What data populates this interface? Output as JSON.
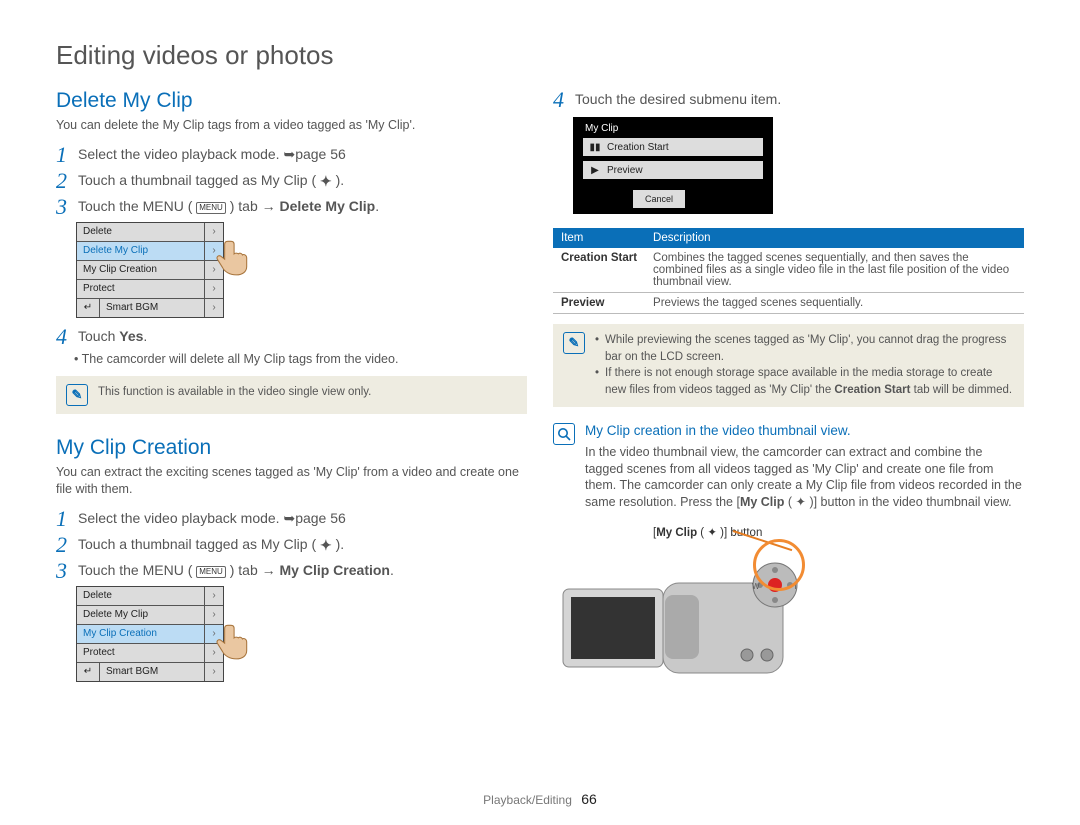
{
  "page": {
    "main_heading": "Editing videos or photos",
    "footer_section": "Playback/Editing",
    "footer_page": "66"
  },
  "delete": {
    "title": "Delete My Clip",
    "intro": "You can delete the My Clip tags from a video tagged as 'My Clip'.",
    "step1_pre": "Select the video playback mode. ",
    "step1_ref": "page 56",
    "step2_pre": "Touch a thumbnail tagged as My Clip ( ",
    "step2_post": " ).",
    "step3_pre": "Touch the MENU ( ",
    "step3_mid": " ) tab ",
    "step3_bold": "Delete My Clip",
    "step4": "Touch ",
    "step4_bold": "Yes",
    "step4_bullet": "The camcorder will delete all My Clip tags from the video.",
    "note": "This function is available in the video single view only.",
    "menu_chip": "MENU",
    "clip_glyph": "✦"
  },
  "creation": {
    "title": "My Clip Creation",
    "intro": "You can extract the exciting scenes tagged as 'My Clip' from a video and create one file with them.",
    "step1_pre": "Select the video playback mode. ",
    "step1_ref": "page 56",
    "step2_pre": "Touch a thumbnail tagged as My Clip ( ",
    "step2_post": " ).",
    "step3_pre": "Touch the MENU ( ",
    "step3_mid": " ) tab ",
    "step3_bold": "My Clip Creation"
  },
  "ui_menu": {
    "items": [
      "Delete",
      "Delete My Clip",
      "My Clip Creation",
      "Protect",
      "Smart BGM"
    ],
    "back": "↵",
    "chev": "›"
  },
  "right": {
    "step4": "Touch the desired submenu item.",
    "num4": "4"
  },
  "submenu": {
    "title": "My Clip",
    "item1": "Creation Start",
    "item2": "Preview",
    "cancel": "Cancel"
  },
  "table": {
    "h_item": "Item",
    "h_desc": "Description",
    "r1_item": "Creation Start",
    "r1_desc": "Combines the tagged scenes sequentially, and then saves the combined files as a single video file in the last file position of the video thumbnail view.",
    "r2_item": "Preview",
    "r2_desc": "Previews the tagged scenes sequentially."
  },
  "note2": {
    "b1": "While previewing the scenes tagged as 'My Clip', you cannot drag the progress bar on the LCD screen.",
    "b2_pre": "If there is not enough storage space available in the media storage to create new files from videos tagged as 'My Clip' the ",
    "b2_bold": "Creation Start",
    "b2_post": " tab will be dimmed."
  },
  "info": {
    "title": "My Clip creation in the video thumbnail view.",
    "body_pre": "In the video thumbnail view, the camcorder can extract and combine the tagged scenes from all videos tagged as 'My Clip' and create one file from them. The camcorder can only create a My Clip file from videos recorded in the same resolution. Press the [",
    "body_bold": "My Clip",
    "body_glyph": " ( ✦ )",
    "body_post": "] button in the video thumbnail view."
  },
  "cam": {
    "label_pre": "[",
    "label_bold": "My Clip",
    "label_glyph": " ( ✦ )",
    "label_post": "] button"
  }
}
